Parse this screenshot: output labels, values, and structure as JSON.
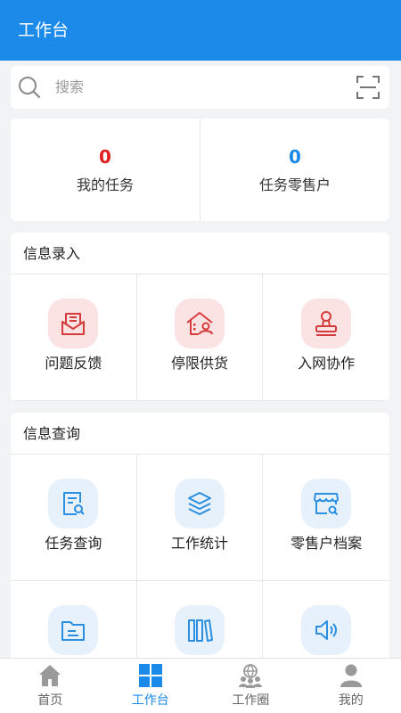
{
  "header": {
    "title": "工作台"
  },
  "search": {
    "placeholder": "搜索"
  },
  "stats": [
    {
      "value": "0",
      "label": "我的任务",
      "color": "#e02020"
    },
    {
      "value": "0",
      "label": "任务零售户",
      "color": "#1b8ae8"
    }
  ],
  "info_entry": {
    "title": "信息录入",
    "items": [
      {
        "label": "问题反馈",
        "icon": "mail-icon"
      },
      {
        "label": "停限供货",
        "icon": "house-person-icon"
      },
      {
        "label": "入网协作",
        "icon": "stamp-icon"
      }
    ]
  },
  "info_query": {
    "title": "信息查询",
    "items": [
      {
        "label": "任务查询",
        "icon": "document-search-icon"
      },
      {
        "label": "工作统计",
        "icon": "layers-icon"
      },
      {
        "label": "零售户档案",
        "icon": "store-search-icon"
      },
      {
        "label": "",
        "icon": "folder-icon"
      },
      {
        "label": "",
        "icon": "books-icon"
      },
      {
        "label": "",
        "icon": "speaker-icon"
      }
    ]
  },
  "tabbar": {
    "items": [
      {
        "label": "首页",
        "icon": "home-icon",
        "active": false
      },
      {
        "label": "工作台",
        "icon": "grid-icon",
        "active": true
      },
      {
        "label": "工作圈",
        "icon": "people-globe-icon",
        "active": false
      },
      {
        "label": "我的",
        "icon": "person-icon",
        "active": false
      }
    ]
  },
  "colors": {
    "primary": "#1b8ae8",
    "danger": "#e02020",
    "icon_red": "#d63b3b",
    "icon_blue": "#2a8fe0"
  }
}
